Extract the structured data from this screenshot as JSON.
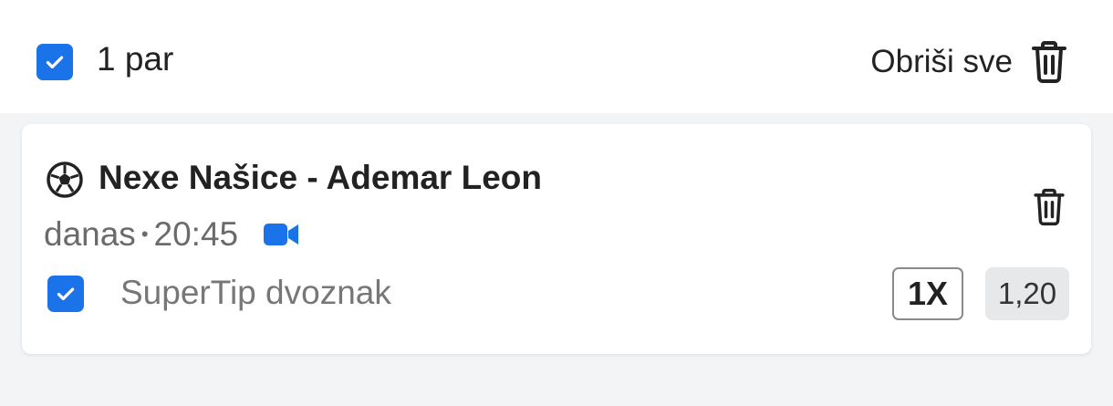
{
  "header": {
    "pair_count_label": "1 par",
    "delete_all_label": "Obriši sve",
    "select_all_checked": true
  },
  "ticket": {
    "sport_icon": "soccer-ball-icon",
    "match_title": "Nexe Našice - Ademar Leon",
    "day": "danas",
    "separator": "•",
    "time": "20:45",
    "video_icon": "video-camera-icon",
    "selected": true,
    "bet_type": "SuperTip dvoznak",
    "tip": "1X",
    "odds": "1,20"
  },
  "colors": {
    "accent": "#1a73e8",
    "background": "#f3f4f6",
    "card": "#ffffff",
    "odds_bg": "#e7e8ea"
  }
}
